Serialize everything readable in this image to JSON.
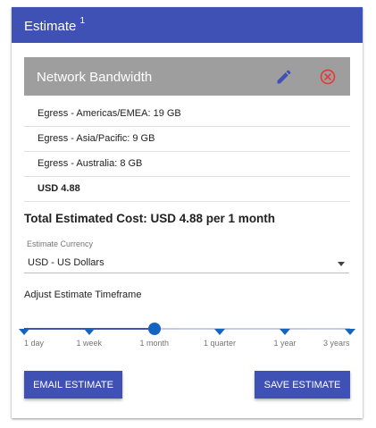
{
  "header": {
    "title": "Estimate",
    "superscript": "1"
  },
  "item": {
    "title": "Network Bandwidth",
    "edit_icon": "pencil-icon",
    "remove_icon": "close-circle-icon"
  },
  "line_items": [
    {
      "label": "Egress - Americas/EMEA: 19 GB"
    },
    {
      "label": "Egress - Asia/Pacific: 9 GB"
    },
    {
      "label": "Egress - Australia: 8 GB"
    },
    {
      "label": "USD 4.88"
    }
  ],
  "total": {
    "text": "Total Estimated Cost: USD 4.88 per 1 month"
  },
  "currency": {
    "label": "Estimate Currency",
    "value": "USD - US Dollars"
  },
  "timeframe": {
    "label": "Adjust Estimate Timeframe",
    "options": [
      "1 day",
      "1 week",
      "1 month",
      "1 quarter",
      "1 year",
      "3 years"
    ],
    "selected_index": 2
  },
  "buttons": {
    "email": "Email Estimate",
    "save": "Save Estimate"
  },
  "colors": {
    "header": "#3f51b5",
    "item_bar": "#9e9e9e",
    "edit_icon": "#3f51b5",
    "remove_icon": "#e53935",
    "slider": "#1565c0",
    "button": "#3f51b5"
  }
}
